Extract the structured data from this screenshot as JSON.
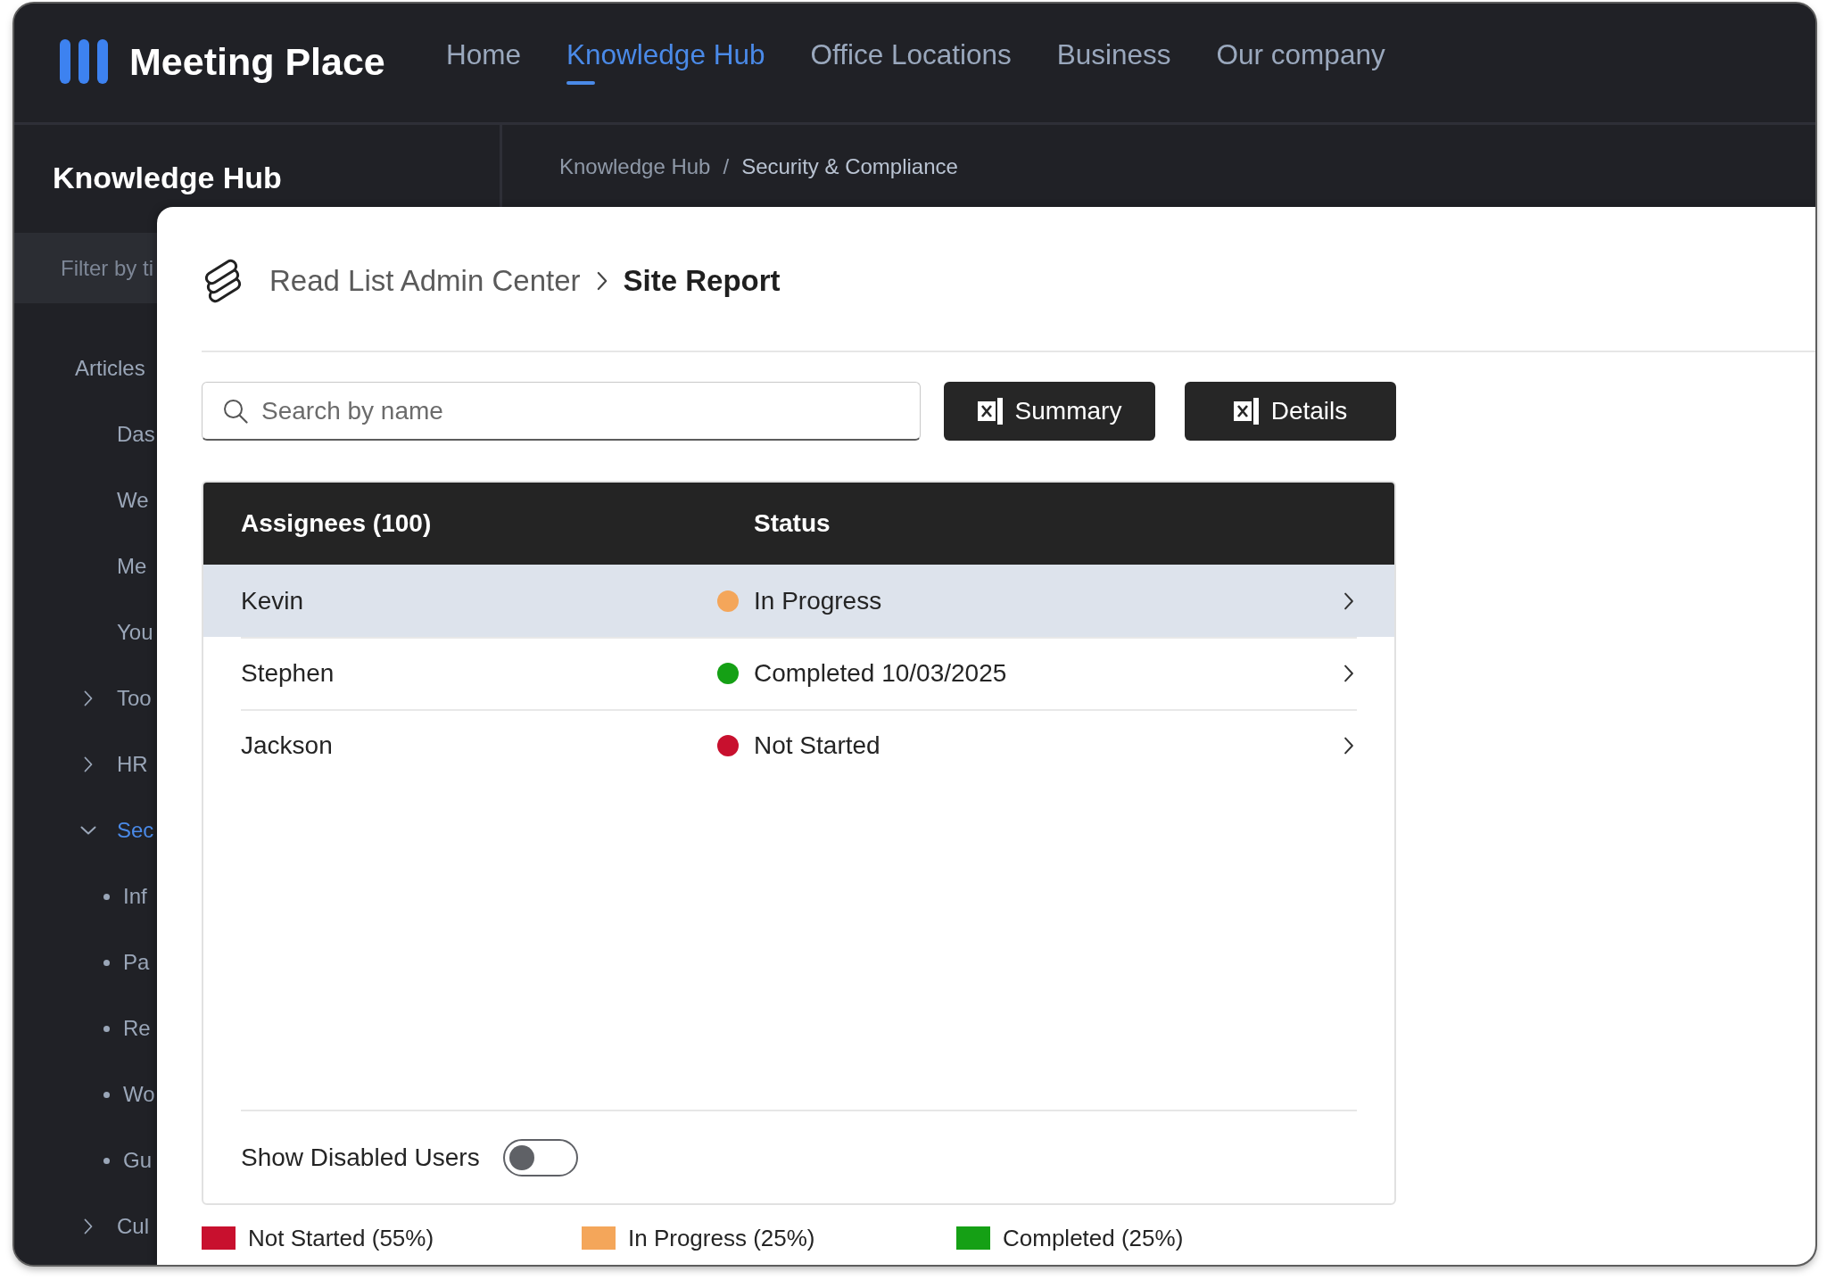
{
  "nav": {
    "brand": "Meeting Place",
    "links": [
      {
        "label": "Home",
        "selected": false
      },
      {
        "label": "Knowledge Hub",
        "selected": true
      },
      {
        "label": "Office Locations",
        "selected": false
      },
      {
        "label": "Business",
        "selected": false
      },
      {
        "label": "Our company",
        "selected": false
      }
    ]
  },
  "sidebar": {
    "title": "Knowledge Hub",
    "filter": {
      "placeholder": "Filter by ti"
    },
    "tree": [
      {
        "label": "Articles",
        "kind": "section",
        "selected": false,
        "children": [
          {
            "label": "Das",
            "kind": "page",
            "selected": false
          },
          {
            "label": "We",
            "kind": "page",
            "selected": false
          },
          {
            "label": "Me",
            "kind": "page",
            "selected": false
          },
          {
            "label": "You",
            "kind": "page",
            "selected": false
          },
          {
            "label": "Too",
            "kind": "folder",
            "expanded": false,
            "selected": false
          },
          {
            "label": "HR",
            "kind": "folder",
            "expanded": false,
            "selected": false
          },
          {
            "label": "Sec",
            "kind": "folder",
            "expanded": true,
            "selected": true,
            "children": [
              {
                "label": "Inf",
                "kind": "page",
                "selected": false
              },
              {
                "label": "Pa",
                "kind": "page",
                "selected": false
              },
              {
                "label": "Re",
                "kind": "page",
                "selected": false
              },
              {
                "label": "Wo",
                "kind": "page",
                "selected": false
              },
              {
                "label": "Gu",
                "kind": "page",
                "selected": false
              }
            ]
          },
          {
            "label": "Cul",
            "kind": "folder",
            "expanded": false,
            "selected": false
          }
        ]
      }
    ]
  },
  "breadcrumb": {
    "separator": "/",
    "items": [
      {
        "label": "Knowledge Hub",
        "selected": false
      },
      {
        "label": "Security & Compliance",
        "selected": true
      }
    ]
  },
  "panel": {
    "header": {
      "app": "Read List Admin Center",
      "page": "Site Report"
    },
    "search": {
      "placeholder": "Search by name"
    },
    "buttons": [
      {
        "label": "Summary"
      },
      {
        "label": "Details"
      }
    ],
    "table": {
      "columns": [
        "Assignees (100)",
        "Status"
      ],
      "rows": [
        {
          "name": "Kevin",
          "status": "In Progress",
          "color": "#f4a65a",
          "selected": true
        },
        {
          "name": "Stephen",
          "status": "Completed 10/03/2025",
          "color": "#15a015",
          "selected": false
        },
        {
          "name": "Jackson",
          "status": "Not Started",
          "color": "#c8102e",
          "selected": false
        }
      ]
    },
    "toggle": {
      "label": "Show Disabled Users",
      "on": false
    },
    "legend": [
      {
        "label": "Not Started (55%)",
        "color": "#c8102e"
      },
      {
        "label": "In Progress (25%)",
        "color": "#f4a65a"
      },
      {
        "label": "Completed (25%)",
        "color": "#15a015"
      }
    ]
  }
}
